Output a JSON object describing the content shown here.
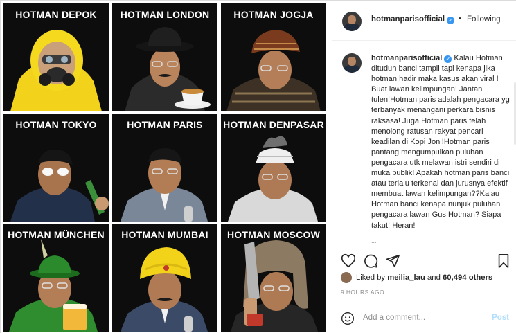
{
  "post": {
    "username": "hotmanparisofficial",
    "verified_mark": "✓",
    "separator": "•",
    "follow_status": "Following",
    "caption": "Kalau Hotman dituduh banci tampil tapi kenapa jika hotman hadir maka kasus akan viral ! Buat lawan kelimpungan! Jantan tulen!Hotman paris adalah pengacara yg terbanyak menangani perkara bisnis raksasa! Juga Hotman paris telah menolong ratusan rakyat pencari keadilan di Kopi Joni!Hotman paris pantang mengumpulkan puluhan pengacara utk melawan istri sendiri di muka publik! Apakah hotman paris banci atau terlalu terkenal dan jurusnya efektif membuat lawan kelimpungan??Kalau Hotman banci kenapa nunjuk puluhan pengacara lawan Gus Hotman? Siapa takut! Heran!",
    "more_hint": "..."
  },
  "likes": {
    "prefix": "Liked by",
    "user": "meilia_lau",
    "middle": "and",
    "count": "60,494 others"
  },
  "timestamp": "9 HOURS AGO",
  "comment_box": {
    "placeholder": "Add a comment...",
    "post_label": "Post"
  },
  "tiles": [
    {
      "title": "HOTMAN DEPOK"
    },
    {
      "title": "HOTMAN LONDON"
    },
    {
      "title": "HOTMAN JOGJA"
    },
    {
      "title": "HOTMAN TOKYO"
    },
    {
      "title": "HOTMAN PARIS"
    },
    {
      "title": "HOTMAN DENPASAR"
    },
    {
      "title": "HOTMAN MÜNCHEN"
    },
    {
      "title": "HOTMAN MUMBAI"
    },
    {
      "title": "HOTMAN MOSCOW"
    }
  ],
  "icons": {
    "like": "heart-icon",
    "comment": "comment-icon",
    "share": "share-icon",
    "save": "bookmark-icon",
    "emoji": "emoji-icon"
  }
}
